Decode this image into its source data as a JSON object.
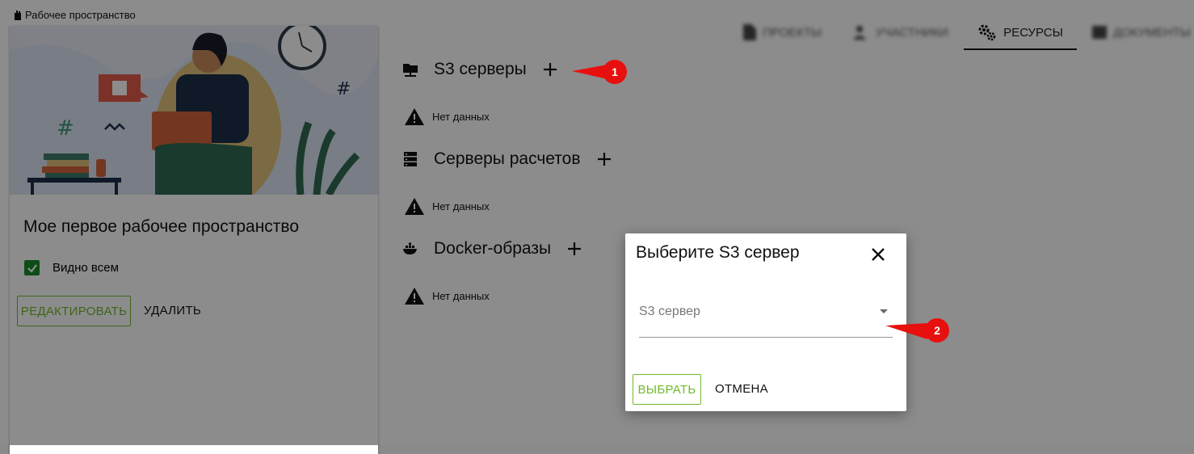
{
  "breadcrumb": {
    "label": "Рабочее пространство"
  },
  "card": {
    "title": "Мое первое рабочее пространство",
    "visible_label": "Видно всем",
    "visible_checked": true,
    "edit_label": "РЕДАКТИРОВАТЬ",
    "delete_label": "УДАЛИТЬ"
  },
  "tabs": [
    {
      "label": "ПРОЕКТЫ",
      "blurred": true
    },
    {
      "label": "УЧАСТНИКИ",
      "blurred": true
    },
    {
      "label": "РЕСУРСЫ",
      "active": true
    },
    {
      "label": "ДОКУМЕНТЫ",
      "blurred": true
    }
  ],
  "sections": [
    {
      "title": "S3 серверы",
      "empty": "Нет данных"
    },
    {
      "title": "Серверы расчетов",
      "empty": "Нет данных"
    },
    {
      "title": "Docker-образы",
      "empty": "Нет данных"
    }
  ],
  "dialog": {
    "title": "Выберите S3 сервер",
    "field_placeholder": "S3 сервер",
    "choose_label": "ВЫБРАТЬ",
    "cancel_label": "ОТМЕНА"
  },
  "callouts": [
    "1",
    "2"
  ],
  "colors": {
    "accent": "#6fba2c",
    "checkbox": "#1b8a2a",
    "callout": "#e8100e"
  }
}
